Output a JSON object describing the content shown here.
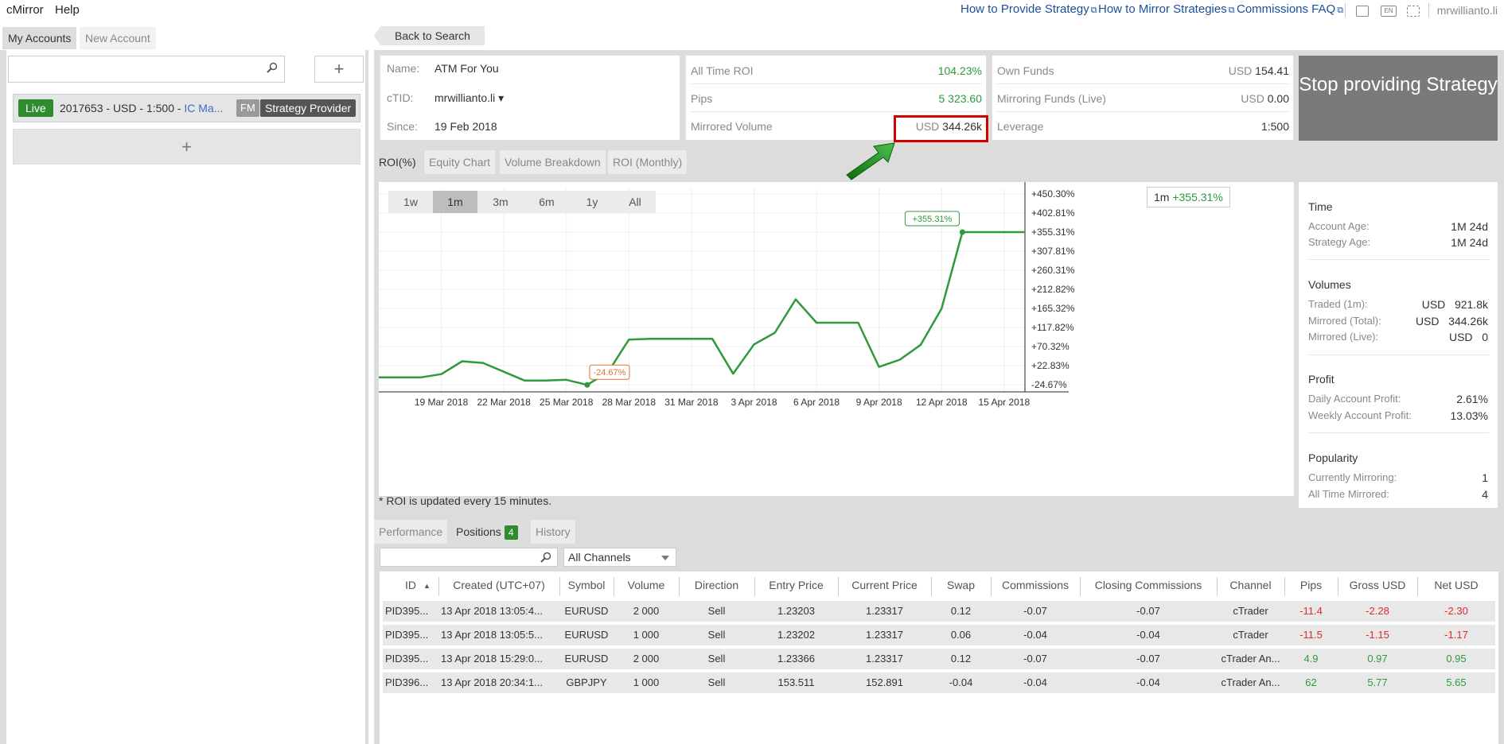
{
  "topbar": {
    "app": "cMirror",
    "help": "Help",
    "links": [
      "How to Provide Strategy",
      "How to Mirror Strategies",
      "Commissions FAQ"
    ],
    "lang": "EN",
    "user": "mrwillianto.li"
  },
  "left": {
    "tabs": [
      "My Accounts",
      "New Account"
    ],
    "add": "+",
    "account": {
      "status": "Live",
      "text": "2017653 - USD - 1:500 - ",
      "broker": "IC Ma...",
      "fm": "FM",
      "role": "Strategy Provider"
    },
    "add_account": "+"
  },
  "back": "Back to Search",
  "info": {
    "name_label": "Name:",
    "name": "ATM For You",
    "ctid_label": "cTID:",
    "ctid": "mrwillianto.li ▾",
    "since_label": "Since:",
    "since": "19 Feb 2018",
    "roi_label": "All Time ROI",
    "roi": "104.23%",
    "pips_label": "Pips",
    "pips": "5 323.60",
    "mv_label": "Mirrored Volume",
    "mv_unit": "USD",
    "mv": "344.26k",
    "own_label": "Own Funds",
    "own_unit": "USD",
    "own": "154.41",
    "mf_label": "Mirroring Funds (Live)",
    "mf_unit": "USD",
    "mf": "0.00",
    "lev_label": "Leverage",
    "lev": "1:500"
  },
  "stop_button": "Stop providing Strategy",
  "chart_tabs": [
    "ROI(%)",
    "Equity Chart",
    "Volume Breakdown",
    "ROI (Monthly)"
  ],
  "ranges": [
    "1w",
    "1m",
    "3m",
    "6m",
    "1y",
    "All"
  ],
  "badge": {
    "period": "1m",
    "value": "+355.31%"
  },
  "chart_data": {
    "type": "line",
    "x": [
      "16 Mar",
      "17 Mar",
      "18 Mar",
      "19 Mar",
      "20 Mar",
      "21 Mar",
      "22 Mar",
      "23 Mar",
      "24 Mar",
      "25 Mar",
      "26 Mar",
      "27 Mar",
      "28 Mar",
      "29 Mar",
      "30 Mar",
      "31 Mar",
      "1 Apr",
      "2 Apr",
      "3 Apr",
      "4 Apr",
      "5 Apr",
      "6 Apr",
      "7 Apr",
      "8 Apr",
      "9 Apr",
      "10 Apr",
      "11 Apr",
      "12 Apr",
      "13 Apr",
      "14 Apr",
      "15 Apr",
      "16 Apr"
    ],
    "values": [
      -6,
      -6,
      -6,
      2,
      34,
      30,
      8,
      -14,
      -14,
      -12,
      -24.67,
      7,
      88,
      90,
      90,
      90,
      90,
      3,
      76,
      105,
      188,
      130,
      130,
      130,
      20,
      38,
      75,
      165,
      355.31,
      355.31,
      355.31,
      355.31
    ],
    "ymin": -42,
    "ymax": 464,
    "yticks": [
      "+450.30%",
      "+402.81%",
      "+355.31%",
      "+307.81%",
      "+260.31%",
      "+212.82%",
      "+165.32%",
      "+117.82%",
      "+70.32%",
      "+22.83%",
      "-24.67%"
    ],
    "ytick_values": [
      450.3,
      402.81,
      355.31,
      307.81,
      260.31,
      212.82,
      165.32,
      117.82,
      70.32,
      22.83,
      -24.67
    ],
    "xticks": [
      "19 Mar 2018",
      "22 Mar 2018",
      "25 Mar 2018",
      "28 Mar 2018",
      "31 Mar 2018",
      "3 Apr 2018",
      "6 Apr 2018",
      "9 Apr 2018",
      "12 Apr 2018",
      "15 Apr 2018"
    ],
    "xtick_index": [
      3,
      6,
      9,
      12,
      15,
      18,
      21,
      24,
      27,
      30
    ],
    "min_label": "-24.67%",
    "max_label": "+355.31%",
    "color": "#2e9a3c",
    "min_color": "#e8702a"
  },
  "side": {
    "time": "Time",
    "account_age_label": "Account Age:",
    "account_age": "1M 24d",
    "strategy_age_label": "Strategy Age:",
    "strategy_age": "1M 24d",
    "volumes": "Volumes",
    "traded_label": "Traded (1m):",
    "traded_unit": "USD",
    "traded": "921.8k",
    "mirrored_total_label": "Mirrored (Total):",
    "mirrored_total_unit": "USD",
    "mirrored_total": "344.26k",
    "mirrored_live_label": "Mirrored (Live):",
    "mirrored_live_unit": "USD",
    "mirrored_live": "0",
    "profit": "Profit",
    "daily_label": "Daily Account Profit:",
    "daily": "2.61%",
    "weekly_label": "Weekly Account Profit:",
    "weekly": "13.03%",
    "popularity": "Popularity",
    "currently_label": "Currently Mirroring:",
    "currently": "1",
    "alltime_label": "All Time Mirrored:",
    "alltime": "4"
  },
  "note": "* ROI is updated every 15 minutes.",
  "bottom_tabs": {
    "performance": "Performance",
    "positions": "Positions",
    "positions_count": "4",
    "history": "History"
  },
  "channel_select": "All Channels",
  "table": {
    "headers": [
      "ID",
      "Created (UTC+07)",
      "Symbol",
      "Volume",
      "Direction",
      "Entry Price",
      "Current Price",
      "Swap",
      "Commissions",
      "Closing Commissions",
      "Channel",
      "Pips",
      "Gross USD",
      "Net USD"
    ],
    "rows": [
      [
        "PID395...",
        "13 Apr 2018 13:05:4...",
        "EURUSD",
        "2 000",
        "Sell",
        "1.23203",
        "1.23317",
        "0.12",
        "-0.07",
        "-0.07",
        "cTrader",
        "-11.4",
        "-2.28",
        "-2.30"
      ],
      [
        "PID395...",
        "13 Apr 2018 13:05:5...",
        "EURUSD",
        "1 000",
        "Sell",
        "1.23202",
        "1.23317",
        "0.06",
        "-0.04",
        "-0.04",
        "cTrader",
        "-11.5",
        "-1.15",
        "-1.17"
      ],
      [
        "PID395...",
        "13 Apr 2018 15:29:0...",
        "EURUSD",
        "2 000",
        "Sell",
        "1.23366",
        "1.23317",
        "0.12",
        "-0.07",
        "-0.07",
        "cTrader An...",
        "4.9",
        "0.97",
        "0.95"
      ],
      [
        "PID396...",
        "13 Apr 2018 20:34:1...",
        "GBPJPY",
        "1 000",
        "Sell",
        "153.511",
        "152.891",
        "-0.04",
        "-0.04",
        "-0.04",
        "cTrader An...",
        "62",
        "5.77",
        "5.65"
      ]
    ],
    "row_colors": [
      "red",
      "red",
      "green",
      "green"
    ]
  }
}
